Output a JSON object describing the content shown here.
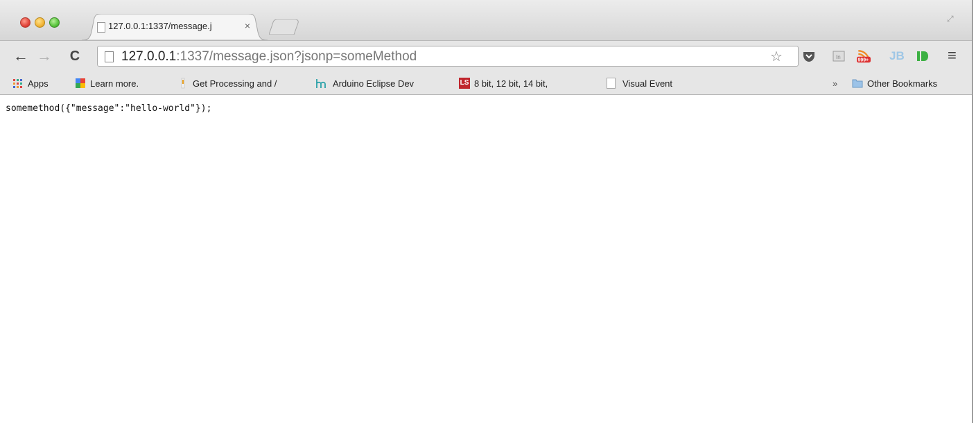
{
  "tab": {
    "title": "127.0.0.1:1337/message.j",
    "close_icon": "close-icon"
  },
  "toolbar": {
    "back_icon": "←",
    "forward_icon": "→",
    "reload_icon": "C",
    "url_host": "127.0.0.1",
    "url_rest": ":1337/message.json?jsonp=someMethod",
    "rss_badge": "999+",
    "jb_label": "JB",
    "menu_icon": "≡"
  },
  "bookmarks": {
    "items": [
      {
        "label": "Apps",
        "icon": "apps-grid-icon"
      },
      {
        "label": "Learn more.",
        "icon": "google-icon"
      },
      {
        "label": "Get Processing and /",
        "icon": "processing-icon"
      },
      {
        "label": "Arduino Eclipse Dev",
        "icon": "arduino-icon"
      },
      {
        "label": "8 bit, 12 bit, 14 bit,",
        "icon": "ls-icon",
        "badge": "LS"
      },
      {
        "label": "Visual Event",
        "icon": "page-icon"
      }
    ],
    "overflow": "»",
    "other": "Other Bookmarks"
  },
  "content": {
    "body_text": "somemethod({\"message\":\"hello-world\"});"
  },
  "colors": {
    "chrome_bg": "#e6e6e6",
    "rss_orange": "#f08a24",
    "badge_red": "#d33",
    "id_green": "#3cb043"
  }
}
